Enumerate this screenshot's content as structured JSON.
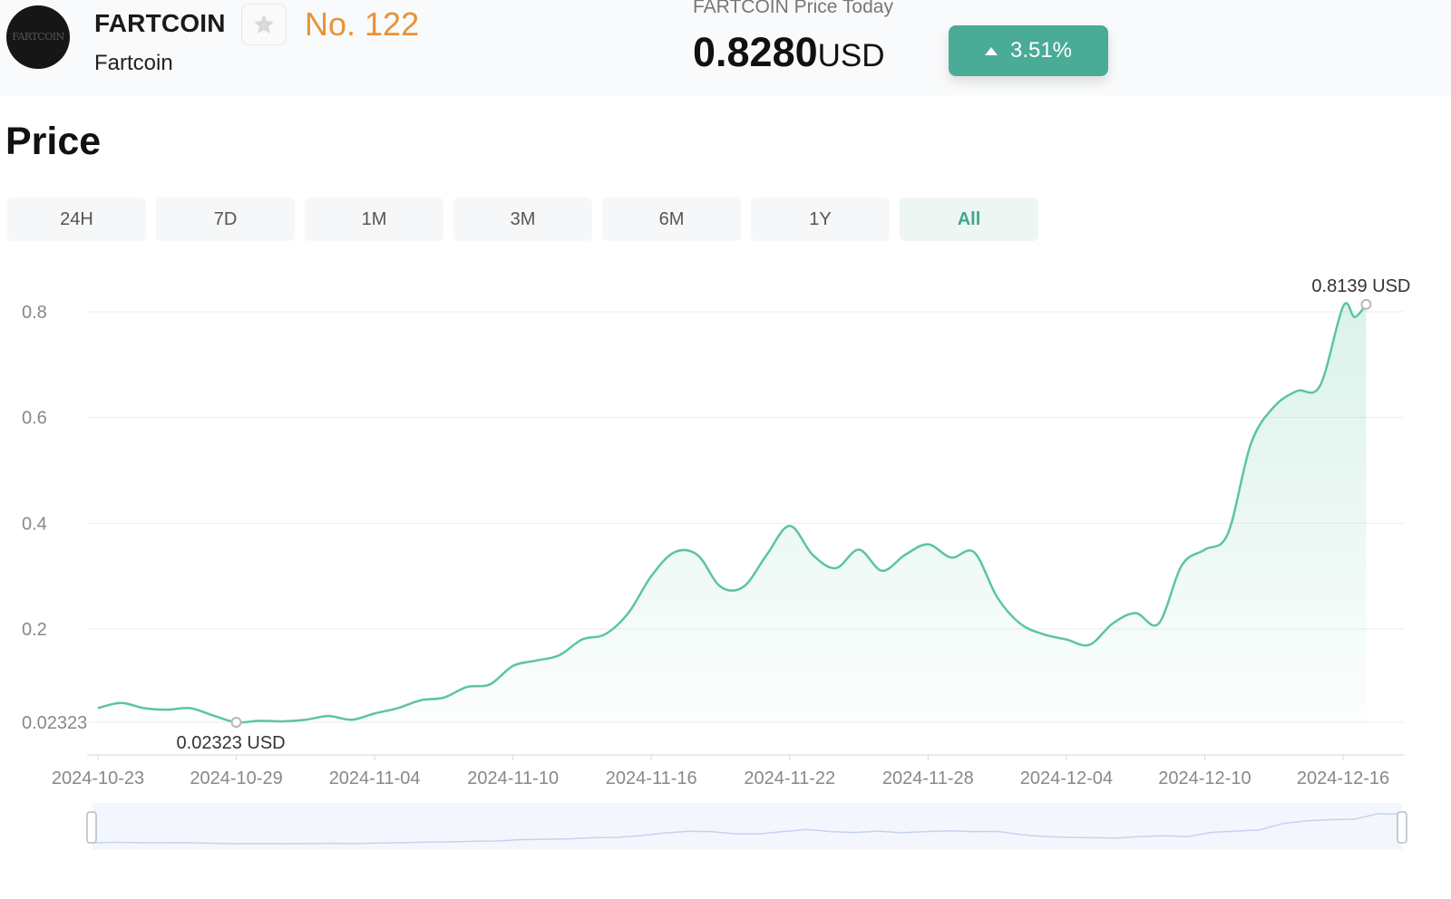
{
  "header": {
    "symbol": "FARTCOIN",
    "name": "Fartcoin",
    "rank": "No. 122",
    "price_title": "FARTCOIN Price Today",
    "price": "0.8280",
    "currency": "USD",
    "change": "3.51%",
    "change_direction": "up",
    "logo_text": "FARTCOIN",
    "icons": {
      "favorite": "star-icon",
      "change": "triangle-up-icon"
    }
  },
  "colors": {
    "accent": "#4aab97",
    "line": "#5cc4a6",
    "rank": "#e8923a",
    "active_tab": "#3fa98f"
  },
  "section": {
    "title": "Price"
  },
  "tabs": [
    {
      "label": "24H",
      "active": false
    },
    {
      "label": "7D",
      "active": false
    },
    {
      "label": "1M",
      "active": false
    },
    {
      "label": "3M",
      "active": false
    },
    {
      "label": "6M",
      "active": false
    },
    {
      "label": "1Y",
      "active": false
    },
    {
      "label": "All",
      "active": true
    }
  ],
  "chart_data": {
    "type": "area",
    "title": "",
    "xlabel": "",
    "ylabel": "",
    "xlim": [
      "2024-10-23",
      "2024-12-17"
    ],
    "ylim": [
      0.02323,
      0.8
    ],
    "y_scale_note": "bottom tick 0.02323 shown",
    "y_ticks": [
      {
        "value": 0.02323,
        "label": "0.02323"
      },
      {
        "value": 0.2,
        "label": "0.2"
      },
      {
        "value": 0.4,
        "label": "0.4"
      },
      {
        "value": 0.6,
        "label": "0.6"
      },
      {
        "value": 0.8,
        "label": "0.8"
      }
    ],
    "x_ticks": [
      "2024-10-23",
      "2024-10-29",
      "2024-11-04",
      "2024-11-10",
      "2024-11-16",
      "2024-11-22",
      "2024-11-28",
      "2024-12-04",
      "2024-12-10",
      "2024-12-16"
    ],
    "grid": true,
    "legend": "none",
    "series": [
      {
        "name": "",
        "points": [
          [
            "2024-10-23",
            0.05
          ],
          [
            "2024-10-24",
            0.06
          ],
          [
            "2024-10-25",
            0.05
          ],
          [
            "2024-10-26",
            0.047
          ],
          [
            "2024-10-27",
            0.05
          ],
          [
            "2024-10-28",
            0.036
          ],
          [
            "2024-10-29",
            0.02323
          ],
          [
            "2024-10-30",
            0.026
          ],
          [
            "2024-10-31",
            0.025
          ],
          [
            "2024-11-01",
            0.028
          ],
          [
            "2024-11-02",
            0.035
          ],
          [
            "2024-11-03",
            0.028
          ],
          [
            "2024-11-04",
            0.04
          ],
          [
            "2024-11-05",
            0.05
          ],
          [
            "2024-11-06",
            0.065
          ],
          [
            "2024-11-07",
            0.07
          ],
          [
            "2024-11-08",
            0.09
          ],
          [
            "2024-11-09",
            0.095
          ],
          [
            "2024-11-10",
            0.13
          ],
          [
            "2024-11-11",
            0.14
          ],
          [
            "2024-11-12",
            0.15
          ],
          [
            "2024-11-13",
            0.18
          ],
          [
            "2024-11-14",
            0.19
          ],
          [
            "2024-11-15",
            0.23
          ],
          [
            "2024-11-16",
            0.3
          ],
          [
            "2024-11-17",
            0.345
          ],
          [
            "2024-11-18",
            0.34
          ],
          [
            "2024-11-19",
            0.28
          ],
          [
            "2024-11-20",
            0.28
          ],
          [
            "2024-11-21",
            0.34
          ],
          [
            "2024-11-22",
            0.395
          ],
          [
            "2024-11-23",
            0.34
          ],
          [
            "2024-11-24",
            0.315
          ],
          [
            "2024-11-25",
            0.35
          ],
          [
            "2024-11-26",
            0.31
          ],
          [
            "2024-11-27",
            0.34
          ],
          [
            "2024-11-28",
            0.36
          ],
          [
            "2024-11-29",
            0.335
          ],
          [
            "2024-11-30",
            0.345
          ],
          [
            "2024-12-01",
            0.26
          ],
          [
            "2024-12-02",
            0.21
          ],
          [
            "2024-12-03",
            0.19
          ],
          [
            "2024-12-04",
            0.18
          ],
          [
            "2024-12-05",
            0.17
          ],
          [
            "2024-12-06",
            0.21
          ],
          [
            "2024-12-07",
            0.23
          ],
          [
            "2024-12-08",
            0.21
          ],
          [
            "2024-12-09",
            0.32
          ],
          [
            "2024-12-10",
            0.35
          ],
          [
            "2024-12-11",
            0.38
          ],
          [
            "2024-12-12",
            0.55
          ],
          [
            "2024-12-13",
            0.62
          ],
          [
            "2024-12-14",
            0.65
          ],
          [
            "2024-12-15",
            0.66
          ],
          [
            "2024-12-16",
            0.81
          ],
          [
            "2024-12-16T12",
            0.79
          ],
          [
            "2024-12-17",
            0.8139
          ]
        ]
      }
    ],
    "annotations": [
      {
        "x": "2024-10-29",
        "y": 0.02323,
        "label": "0.02323",
        "unit": "USD"
      },
      {
        "x": "2024-12-17",
        "y": 0.8139,
        "label": "0.8139",
        "unit": "USD"
      }
    ]
  }
}
